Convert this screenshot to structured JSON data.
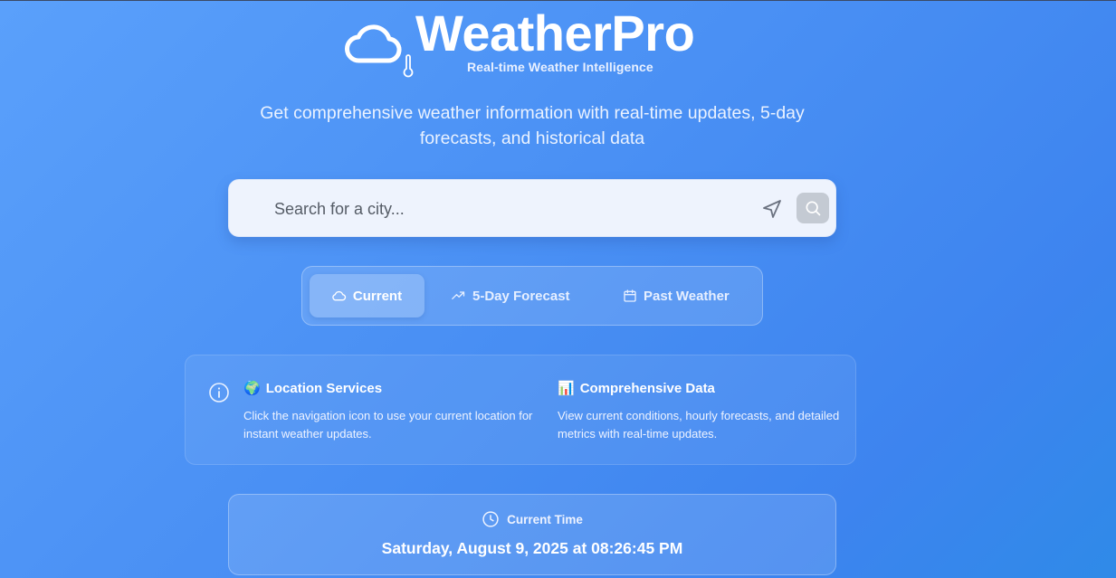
{
  "header": {
    "brand": "WeatherPro",
    "tagline": "Real-time Weather Intelligence",
    "logo_icon": "cloud-icon",
    "thermometer_icon": "thermometer-icon"
  },
  "intro": {
    "text": "Get comprehensive weather information with real-time updates, 5-day forecasts, and historical data"
  },
  "search": {
    "placeholder": "Search for a city...",
    "value": "",
    "location_icon": "navigation-icon",
    "search_icon": "search-icon"
  },
  "tabs": [
    {
      "label": "Current",
      "icon": "cloud-icon",
      "active": true
    },
    {
      "label": "5-Day Forecast",
      "icon": "trending-up-icon",
      "active": false
    },
    {
      "label": "Past Weather",
      "icon": "calendar-icon",
      "active": false
    }
  ],
  "info": {
    "icon": "info-icon",
    "items": [
      {
        "emoji": "🌍",
        "title": "Location Services",
        "text": "Click the navigation icon to use your current location for instant weather updates."
      },
      {
        "emoji": "📊",
        "title": "Comprehensive Data",
        "text": "View current conditions, hourly forecasts, and detailed metrics with real-time updates."
      }
    ]
  },
  "time": {
    "label": "Current Time",
    "value": "Saturday, August 9, 2025 at 08:26:45 PM",
    "icon": "clock-icon"
  },
  "colors": {
    "background_start": "#5aa0fb",
    "background_end": "#3d84ef",
    "search_bg": "#eef3fd",
    "search_button": "#c4cad3"
  }
}
